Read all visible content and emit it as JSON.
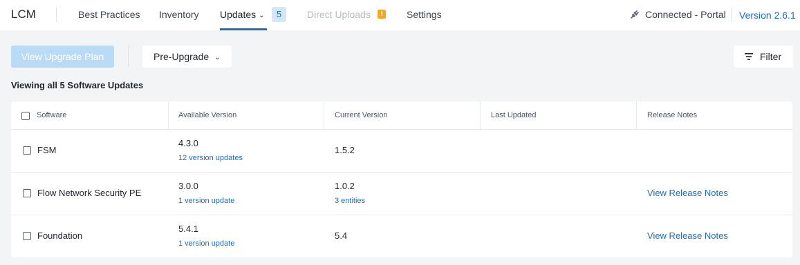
{
  "app": {
    "title": "LCM"
  },
  "nav": {
    "best_practices": "Best Practices",
    "inventory": "Inventory",
    "updates": "Updates",
    "updates_count": "5",
    "direct_uploads": "Direct Uploads",
    "direct_uploads_warning": "!",
    "settings": "Settings"
  },
  "status": {
    "connection": "Connected - Portal",
    "version": "Version 2.6.1"
  },
  "toolbar": {
    "view_upgrade_plan": "View Upgrade Plan",
    "stage_dropdown": "Pre-Upgrade",
    "filter": "Filter"
  },
  "summary": "Viewing all 5 Software Updates",
  "table": {
    "columns": [
      "Software",
      "Available Version",
      "Current Version",
      "Last Updated",
      "Release Notes"
    ],
    "rows": [
      {
        "software": "FSM",
        "available_version": "4.3.0",
        "available_updates": "12 version updates",
        "current_version": "1.5.2",
        "current_sub": "",
        "last_updated": "",
        "release_notes": ""
      },
      {
        "software": "Flow Network Security PE",
        "available_version": "3.0.0",
        "available_updates": "1 version update",
        "current_version": "1.0.2",
        "current_sub": "3 entities",
        "last_updated": "",
        "release_notes": "View Release Notes"
      },
      {
        "software": "Foundation",
        "available_version": "5.4.1",
        "available_updates": "1 version update",
        "current_version": "5.4",
        "current_sub": "",
        "last_updated": "",
        "release_notes": "View Release Notes"
      }
    ]
  },
  "icons": {
    "plug": "plug-icon",
    "filter": "filter-icon",
    "chevron": "chevron-down-icon"
  },
  "colors": {
    "accent": "#1b6dc1",
    "badge_bg": "#d4e7f8",
    "warning": "#f5a623",
    "disabled_button": "#b9dbf5",
    "background": "#f3f4f6"
  }
}
